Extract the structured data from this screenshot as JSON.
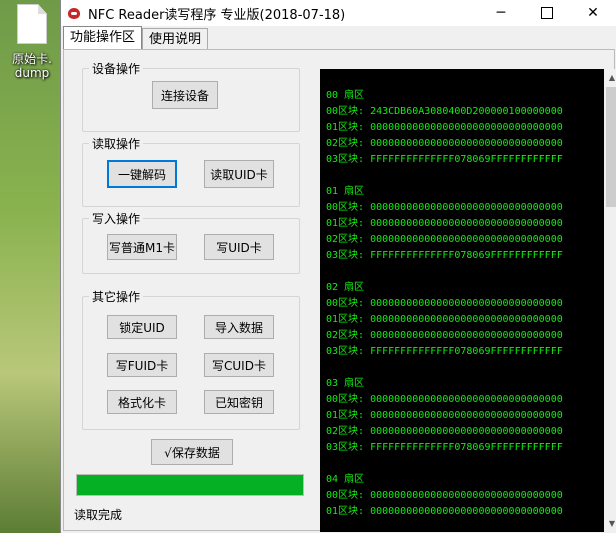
{
  "desktop": {
    "file_label": "原始卡.\ndump"
  },
  "window": {
    "title": "NFC Reader读写程序 专业版(2018-07-18)",
    "minimize": "─",
    "close": "✕"
  },
  "tabs": [
    {
      "label": "功能操作区"
    },
    {
      "label": "使用说明"
    }
  ],
  "groups": {
    "device": {
      "title": "设备操作",
      "buttons": {
        "connect": "连接设备"
      }
    },
    "read": {
      "title": "读取操作",
      "buttons": {
        "decode": "一键解码",
        "read_uid": "读取UID卡"
      }
    },
    "write": {
      "title": "写入操作",
      "buttons": {
        "write_m1": "写普通M1卡",
        "write_uid": "写UID卡"
      }
    },
    "other": {
      "title": "其它操作",
      "buttons": {
        "lock_uid": "锁定UID",
        "import": "导入数据",
        "write_fuid": "写FUID卡",
        "write_cuid": "写CUID卡",
        "format": "格式化卡",
        "known_keys": "已知密钥"
      }
    }
  },
  "save_button": "√保存数据",
  "progress": {
    "percent": 100,
    "color": "#06b025"
  },
  "status_text": "读取完成",
  "console": {
    "text_color": "#11ee11",
    "lines": [
      "00 扇区",
      "00区块: 243CDB60A3080400D200000100000000",
      "01区块: 00000000000000000000000000000000",
      "02区块: 00000000000000000000000000000000",
      "03区块: FFFFFFFFFFFFFF078069FFFFFFFFFFFF",
      "",
      "01 扇区",
      "00区块: 00000000000000000000000000000000",
      "01区块: 00000000000000000000000000000000",
      "02区块: 00000000000000000000000000000000",
      "03区块: FFFFFFFFFFFFFF078069FFFFFFFFFFFF",
      "",
      "02 扇区",
      "00区块: 00000000000000000000000000000000",
      "01区块: 00000000000000000000000000000000",
      "02区块: 00000000000000000000000000000000",
      "03区块: FFFFFFFFFFFFFF078069FFFFFFFFFFFF",
      "",
      "03 扇区",
      "00区块: 00000000000000000000000000000000",
      "01区块: 00000000000000000000000000000000",
      "02区块: 00000000000000000000000000000000",
      "03区块: FFFFFFFFFFFFFF078069FFFFFFFFFFFF",
      "",
      "04 扇区",
      "00区块: 00000000000000000000000000000000",
      "01区块: 00000000000000000000000000000000"
    ]
  }
}
